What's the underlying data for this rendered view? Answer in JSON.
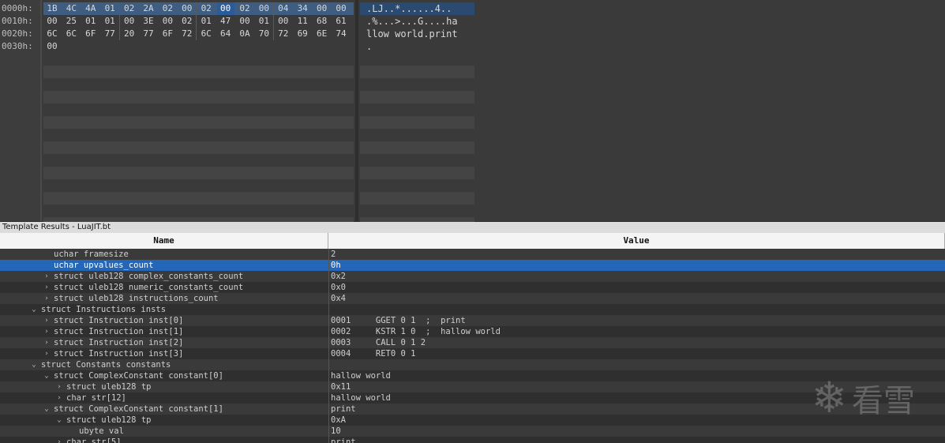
{
  "hex": {
    "addresses": [
      "0000h:",
      "0010h:",
      "0020h:",
      "0030h:"
    ],
    "rows": [
      [
        "1B",
        "4C",
        "4A",
        "01",
        "02",
        "2A",
        "02",
        "00",
        "02",
        "00",
        "02",
        "00",
        "04",
        "34",
        "00",
        "00"
      ],
      [
        "00",
        "25",
        "01",
        "01",
        "00",
        "3E",
        "00",
        "02",
        "01",
        "47",
        "00",
        "01",
        "00",
        "11",
        "68",
        "61"
      ],
      [
        "6C",
        "6C",
        "6F",
        "77",
        "20",
        "77",
        "6F",
        "72",
        "6C",
        "64",
        "0A",
        "70",
        "72",
        "69",
        "6E",
        "74"
      ],
      [
        "00"
      ]
    ],
    "ascii": [
      ".LJ..*......4..",
      ".%...>...G....ha",
      "llow world.print",
      "."
    ]
  },
  "template_panel": {
    "title": "Template Results - LuaJIT.bt",
    "col_name": "Name",
    "col_value": "Value"
  },
  "tree_rows": [
    {
      "caret": "",
      "name": "uchar framesize",
      "value": "2"
    },
    {
      "caret": "",
      "name": "uchar upvalues_count",
      "value": "0h"
    },
    {
      "caret": ">",
      "name": "struct uleb128 complex_constants_count",
      "value": "0x2"
    },
    {
      "caret": ">",
      "name": "struct uleb128 numeric_constants_count",
      "value": "0x0"
    },
    {
      "caret": ">",
      "name": "struct uleb128 instructions_count",
      "value": "0x4"
    },
    {
      "caret": "v",
      "name": "struct Instructions insts",
      "value": ""
    },
    {
      "caret": ">",
      "name": "struct Instruction inst[0]",
      "value": "0001     GGET 0 1  ;  print"
    },
    {
      "caret": ">",
      "name": "struct Instruction inst[1]",
      "value": "0002     KSTR 1 0  ;  hallow world"
    },
    {
      "caret": ">",
      "name": "struct Instruction inst[2]",
      "value": "0003     CALL 0 1 2"
    },
    {
      "caret": ">",
      "name": "struct Instruction inst[3]",
      "value": "0004     RET0 0 1"
    },
    {
      "caret": "v",
      "name": "struct Constants constants",
      "value": ""
    },
    {
      "caret": "v",
      "name": "struct ComplexConstant constant[0]",
      "value": "hallow world"
    },
    {
      "caret": ">",
      "name": "struct uleb128 tp",
      "value": "0x11"
    },
    {
      "caret": ">",
      "name": "char str[12]",
      "value": "hallow world"
    },
    {
      "caret": "v",
      "name": "struct ComplexConstant constant[1]",
      "value": "print"
    },
    {
      "caret": "v",
      "name": "struct uleb128 tp",
      "value": "0xA"
    },
    {
      "caret": "",
      "name": "ubyte val",
      "value": "10"
    },
    {
      "caret": ">",
      "name": "char str[5]",
      "value": "print"
    }
  ],
  "watermark": {
    "text": "看雪",
    "icon": "snowflake-icon"
  },
  "colors": {
    "selection": "#2466b8",
    "panel_bg": "#2f2f2f"
  }
}
